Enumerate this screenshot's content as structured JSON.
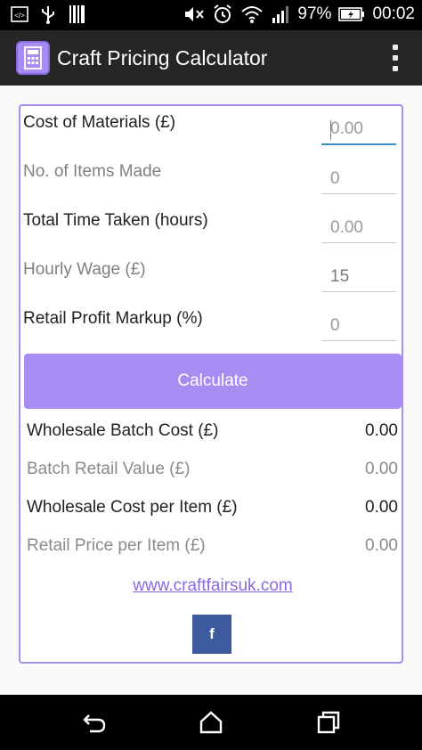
{
  "status_bar": {
    "battery": "97%",
    "time": "00:02",
    "icons": [
      "code-icon",
      "usb-icon",
      "barcode-icon",
      "mute-icon",
      "alarm-icon",
      "wifi-icon",
      "signal-icon",
      "battery-icon"
    ]
  },
  "app_bar": {
    "title": "Craft Pricing Calculator",
    "logo_icon": "calculator-icon",
    "menu_icon": "overflow-menu-icon"
  },
  "form": {
    "fields": [
      {
        "label": "Cost of Materials (£)",
        "placeholder": "0.00",
        "value": ""
      },
      {
        "label": "No. of Items Made",
        "placeholder": "0",
        "value": ""
      },
      {
        "label": "Total Time Taken (hours)",
        "placeholder": "0.00",
        "value": ""
      },
      {
        "label": "Hourly Wage (£)",
        "placeholder": "",
        "value": "15"
      },
      {
        "label": "Retail Profit Markup (%)",
        "placeholder": "0",
        "value": ""
      }
    ],
    "calculate_label": "Calculate"
  },
  "results": [
    {
      "label": "Wholesale Batch Cost (£)",
      "value": "0.00"
    },
    {
      "label": "Batch Retail Value (£)",
      "value": "0.00"
    },
    {
      "label": "Wholesale Cost per Item (£)",
      "value": "0.00"
    },
    {
      "label": "Retail Price per Item (£)",
      "value": "0.00"
    }
  ],
  "footer": {
    "link": "www.craftfairsuk.com",
    "facebook": "f"
  },
  "colors": {
    "accent": "#a98cf2",
    "link": "#8a68e6",
    "facebook": "#3d5a9e",
    "focus": "#3a8ec9"
  }
}
